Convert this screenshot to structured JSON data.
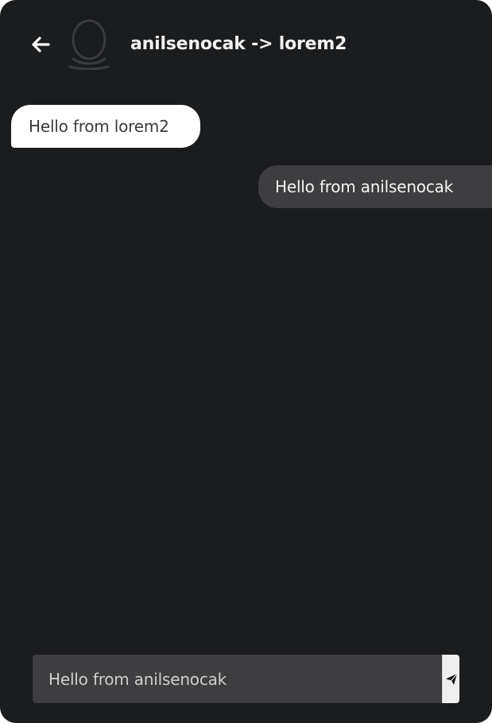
{
  "header": {
    "title": "anilsenocak -> lorem2",
    "back_icon": "arrow-left-icon",
    "avatar_icon": "user-avatar-icon"
  },
  "messages": [
    {
      "direction": "incoming",
      "text": "Hello from lorem2"
    },
    {
      "direction": "outgoing",
      "text": "Hello from anilsenocak"
    }
  ],
  "composer": {
    "value": "Hello from anilsenocak",
    "send_icon": "paper-plane-icon"
  },
  "colors": {
    "background": "#1b1c1e",
    "incoming_bubble": "#ffffff",
    "outgoing_bubble": "#3e3e40",
    "input_background": "#3e3e40",
    "send_button": "#efefef"
  }
}
